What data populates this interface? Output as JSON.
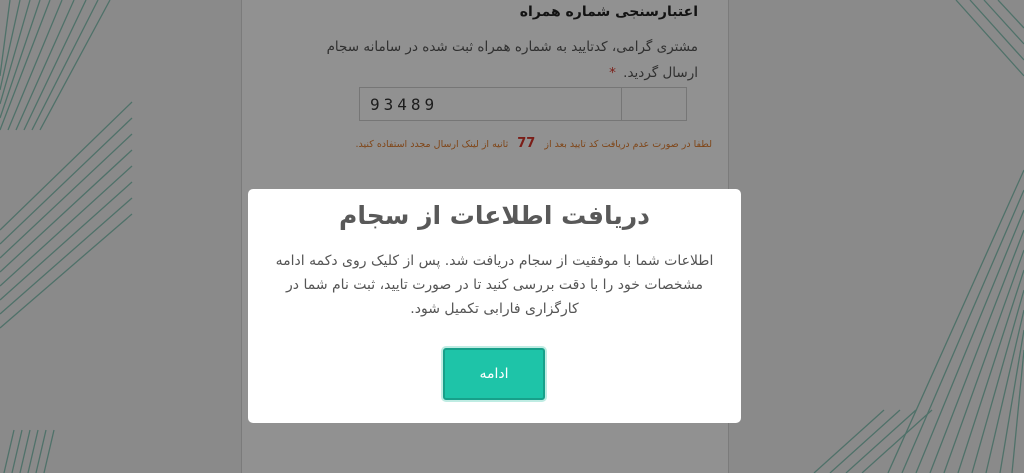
{
  "verification": {
    "title": "اعتبارسنجی شماره همراه",
    "description": "مشتری گرامی، کدتایید به شماره همراه ثبت شده در سامانه سجام ارسال گردید.",
    "required_mark": "*",
    "code_value": "93489",
    "countdown_before": "لطفا در صورت عدم دریافت کد تایید بعد از",
    "countdown_seconds": "77",
    "countdown_after": "ثانیه از لینک ارسال مجدد استفاده کنید."
  },
  "modal": {
    "title": "دریافت اطلاعات از سجام",
    "body": "اطلاعات شما با موفقیت از سجام دریافت شد. پس از کلیک روی دکمه ادامه مشخصات خود را با دقت بررسی کنید تا در صورت تایید، ثبت نام شما در کارگزاری فارابی تکمیل شود.",
    "continue_label": "ادامه"
  },
  "colors": {
    "accent": "#1ec4a8",
    "warning_text": "#e07b2b",
    "required": "#d9362b",
    "decor_stripes": "#3aa58c"
  }
}
